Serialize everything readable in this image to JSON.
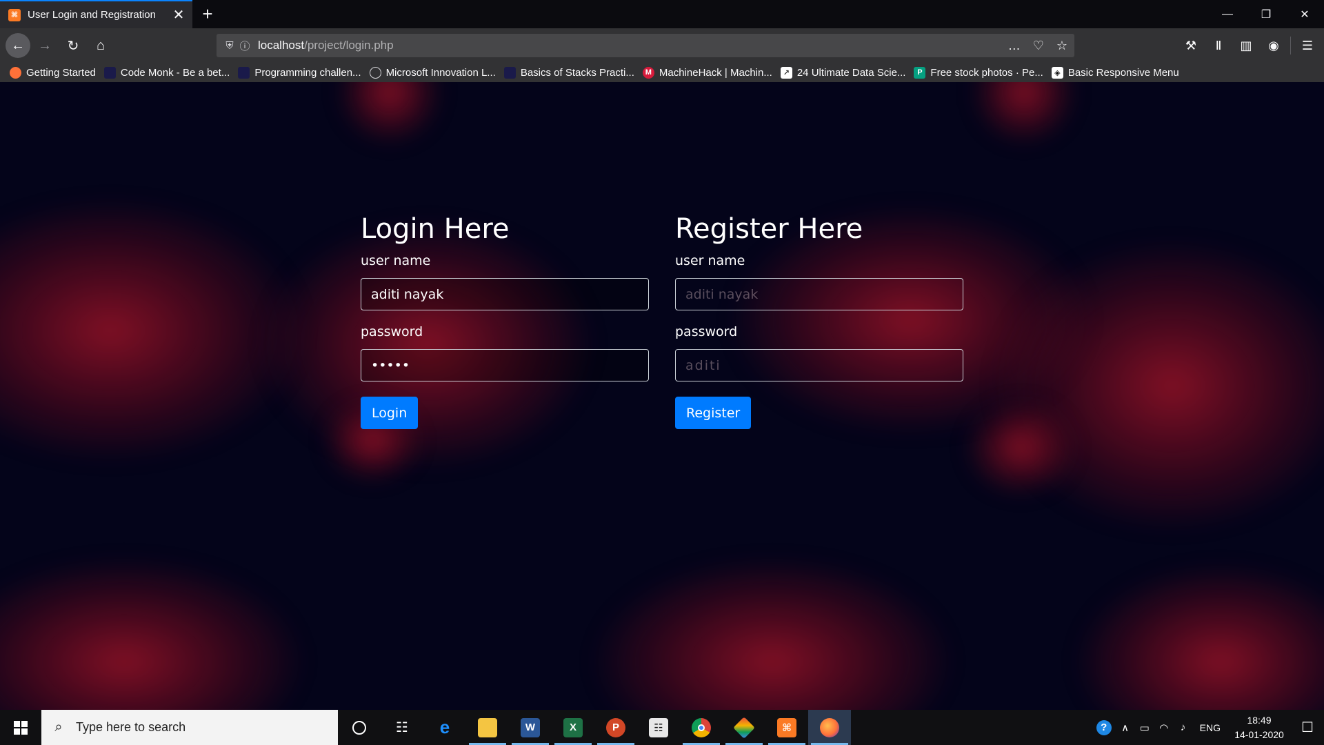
{
  "browser": {
    "tab_title": "User Login and Registration",
    "url_host": "localhost",
    "url_path": "/project/login.php",
    "bookmarks": [
      {
        "label": "Getting Started",
        "icon": "firefox-icon",
        "color": "#ff7139"
      },
      {
        "label": "Code Monk - Be a bet...",
        "icon": "code-monk-icon",
        "color": "#1a1a4a"
      },
      {
        "label": "Programming challen...",
        "icon": "programming-icon",
        "color": "#1a1a4a"
      },
      {
        "label": "Microsoft Innovation L...",
        "icon": "globe-icon",
        "color": "#323234"
      },
      {
        "label": "Basics of Stacks Practi...",
        "icon": "stacks-icon",
        "color": "#1a1a4a"
      },
      {
        "label": "MachineHack | Machin...",
        "icon": "machinehack-icon",
        "color": "#d81b3c"
      },
      {
        "label": "24 Ultimate Data Scie...",
        "icon": "chart-icon",
        "color": "#ffffff"
      },
      {
        "label": "Free stock photos · Pe...",
        "icon": "pexels-icon",
        "color": "#05a081"
      },
      {
        "label": "Basic Responsive Menu",
        "icon": "codepen-icon",
        "color": "#ffffff"
      }
    ]
  },
  "login": {
    "title": "Login Here",
    "username_label": "user name",
    "username_value": "aditi nayak",
    "password_label": "password",
    "password_value": "aditi",
    "button": "Login"
  },
  "register": {
    "title": "Register Here",
    "username_label": "user name",
    "username_value": "aditi nayak",
    "password_label": "password",
    "password_value": "aditi",
    "button": "Register"
  },
  "taskbar": {
    "search_placeholder": "Type here to search",
    "language": "ENG",
    "time": "18:49",
    "date": "14-01-2020",
    "apps": [
      {
        "name": "cortana-icon",
        "active": false
      },
      {
        "name": "task-view-icon",
        "active": false
      },
      {
        "name": "edge-icon",
        "active": false
      },
      {
        "name": "file-explorer-icon",
        "active": true
      },
      {
        "name": "word-icon",
        "active": true
      },
      {
        "name": "excel-icon",
        "active": true
      },
      {
        "name": "powerpoint-icon",
        "active": true
      },
      {
        "name": "calculator-icon",
        "active": false
      },
      {
        "name": "chrome-icon",
        "active": true
      },
      {
        "name": "git-icon",
        "active": true
      },
      {
        "name": "xampp-icon",
        "active": true
      },
      {
        "name": "firefox-icon",
        "active": true
      }
    ]
  },
  "colors": {
    "accent_button": "#007bff",
    "page_background": "#04041a",
    "nebula": "#b0142a"
  }
}
